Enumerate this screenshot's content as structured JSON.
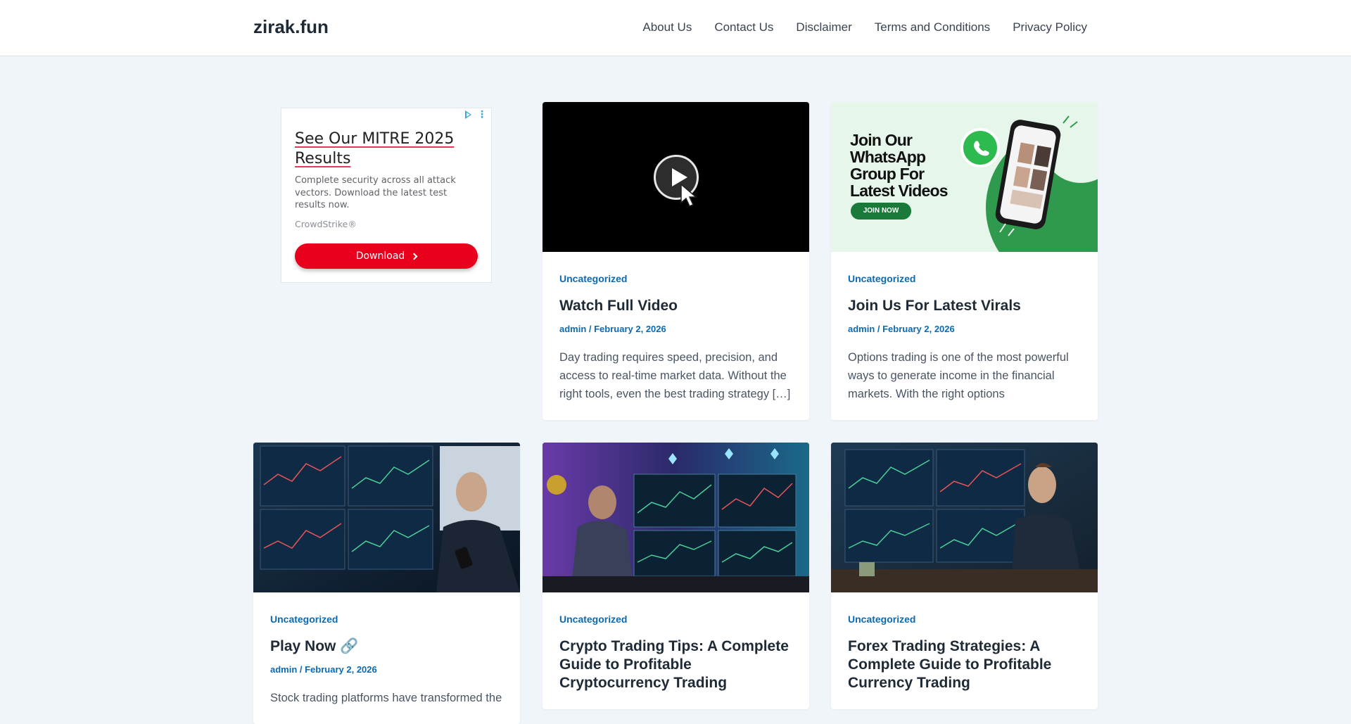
{
  "site": {
    "logo": "zirak.fun",
    "nav": [
      "About Us",
      "Contact Us",
      "Disclaimer",
      "Terms and Conditions",
      "Privacy Policy"
    ]
  },
  "ad": {
    "title": "See Our MITRE 2025 Results",
    "description": "Complete security across all attack vectors. Download the latest test results now.",
    "brand": "CrowdStrike®",
    "button_label": "Download",
    "accent": "#e8001c"
  },
  "posts": [
    {
      "category": "Uncategorized",
      "title": "Watch Full Video",
      "author": "admin",
      "date": "February 2, 2026",
      "meta": "admin / February 2, 2026",
      "excerpt": "Day trading requires speed, precision, and access to real-time market data. Without the right tools, even the best trading strategy […]",
      "thumb": "video-play-icon"
    },
    {
      "category": "Uncategorized",
      "title": "Join Us For Latest Virals",
      "meta": "admin / February 2, 2026",
      "excerpt": "Options trading is one of the most powerful ways to generate income in the financial markets. With the right options",
      "thumb": "whatsapp-promo",
      "thumb_text": "Join Our WhatsApp Group For Latest Videos",
      "thumb_button": "JOIN NOW"
    },
    {
      "category": "Uncategorized",
      "title": "Play Now 🔗",
      "meta": "admin / February 2, 2026",
      "excerpt": "Stock trading platforms have transformed the",
      "thumb": "trading-desk-photo"
    },
    {
      "category": "Uncategorized",
      "title": "Crypto Trading Tips: A Complete Guide to Profitable Cryptocurrency Trading",
      "meta": "",
      "excerpt": "",
      "thumb": "crypto-trading-photo"
    },
    {
      "category": "Uncategorized",
      "title": "Forex Trading Strategies: A Complete Guide to Profitable Currency Trading",
      "meta": "",
      "excerpt": "",
      "thumb": "forex-trading-photo"
    }
  ],
  "colors": {
    "link": "#0c6ab2",
    "background": "#f0f5fa",
    "heading": "#1e2a36"
  }
}
